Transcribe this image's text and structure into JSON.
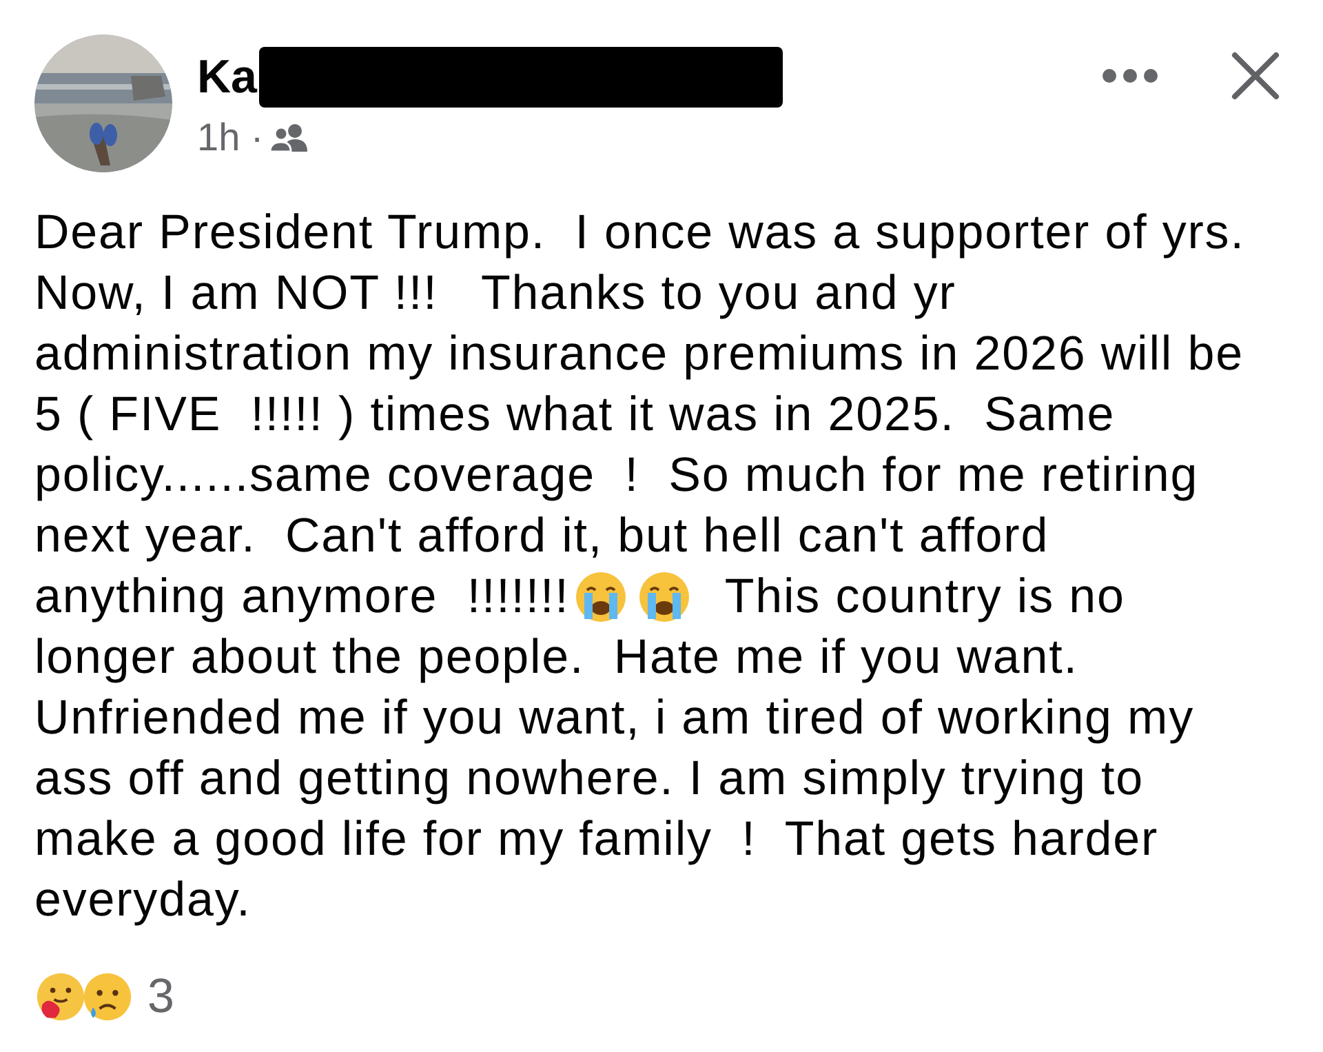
{
  "post": {
    "author": "Ka",
    "time": "1h ·",
    "body_lines": [
      [
        {
          "kind": "text",
          "text": "Dear President Trump.  I once was a supporter of yrs."
        }
      ],
      [
        {
          "kind": "text",
          "text": "Now, I am NOT !!!   Thanks to you and yr"
        }
      ],
      [
        {
          "kind": "text",
          "text": "administration my insurance premiums in 2026 will be"
        }
      ],
      [
        {
          "kind": "text",
          "text": "5 ( FIVE  !!!!! ) times what it was in 2025.  Same"
        }
      ],
      [
        {
          "kind": "text",
          "text": "policy......same coverage  !  So much for me retiring"
        }
      ],
      [
        {
          "kind": "text",
          "text": "next year.  Can't afford it, but hell can't afford"
        }
      ],
      [
        {
          "kind": "text",
          "text": "anything anymore  !!!!!!!"
        },
        {
          "kind": "emoji"
        },
        {
          "kind": "emoji"
        },
        {
          "kind": "text",
          "text": "  This country is no"
        }
      ],
      [
        {
          "kind": "text",
          "text": "longer about the people.  Hate me if you want."
        }
      ],
      [
        {
          "kind": "text",
          "text": "Unfriended me if you want, i am tired of working my"
        }
      ],
      [
        {
          "kind": "text",
          "text": "ass off and getting nowhere. I am simply trying to"
        }
      ],
      [
        {
          "kind": "text",
          "text": "make a good life for my family  !  That gets harder"
        }
      ],
      [
        {
          "kind": "text",
          "text": "everyday."
        }
      ]
    ],
    "reactions": {
      "count": "3"
    }
  }
}
